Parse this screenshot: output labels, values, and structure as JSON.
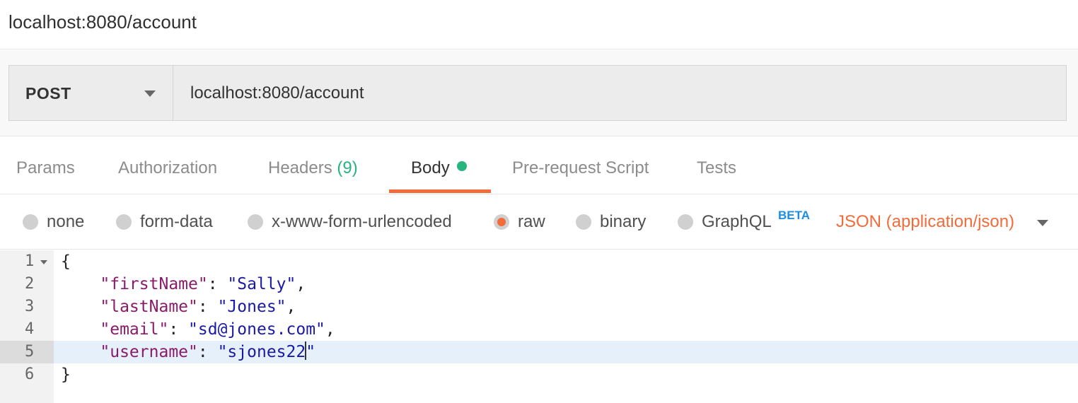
{
  "window": {
    "title": "localhost:8080/account"
  },
  "request": {
    "method": "POST",
    "url": "localhost:8080/account"
  },
  "tabs": [
    {
      "label": "Params"
    },
    {
      "label": "Authorization"
    },
    {
      "label": "Headers",
      "count": "(9)"
    },
    {
      "label": "Body",
      "active": true,
      "indicator": "green-dot"
    },
    {
      "label": "Pre-request Script"
    },
    {
      "label": "Tests"
    }
  ],
  "body_types": [
    {
      "label": "none",
      "selected": false
    },
    {
      "label": "form-data",
      "selected": false
    },
    {
      "label": "x-www-form-urlencoded",
      "selected": false
    },
    {
      "label": "raw",
      "selected": true
    },
    {
      "label": "binary",
      "selected": false
    },
    {
      "label": "GraphQL",
      "selected": false,
      "badge": "BETA"
    }
  ],
  "content_type": "JSON (application/json)",
  "editor": {
    "lines": [
      {
        "num": "1",
        "text": "{"
      },
      {
        "num": "2",
        "key": "\"firstName\"",
        "value": "\"Sally\"",
        "trail": ","
      },
      {
        "num": "3",
        "key": "\"lastName\"",
        "value": "\"Jones\"",
        "trail": ","
      },
      {
        "num": "4",
        "key": "\"email\"",
        "value": "\"sd@jones.com\"",
        "trail": ","
      },
      {
        "num": "5",
        "key": "\"username\"",
        "value_before_cursor": "\"sjones22",
        "value_after_cursor": "\"",
        "active": true
      },
      {
        "num": "6",
        "text": "}"
      }
    ]
  },
  "colors": {
    "accent": "#f26b3a",
    "success": "#26b47f",
    "beta": "#1a8fe3",
    "json_key": "#8a1b6a",
    "json_string": "#1a1aa6",
    "active_line": "#e6f0fb"
  }
}
